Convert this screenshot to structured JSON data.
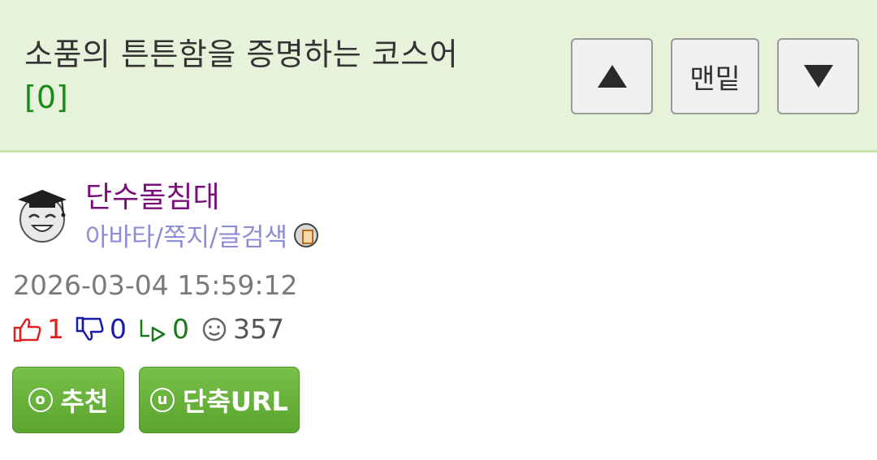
{
  "header": {
    "title": "소품의 튼튼함을 증명하는 코스어",
    "comment_count": "[0]",
    "nav": {
      "up_icon": "triangle-up-icon",
      "bottom_label": "맨밑",
      "down_icon": "triangle-down-icon"
    }
  },
  "author": {
    "avatar_icon": "graduate-smiley-avatar",
    "name": "단수돌침대",
    "links": "아바타/쪽지/글검색",
    "message_icon": "message-icon"
  },
  "meta": {
    "timestamp": "2026-03-04 15:59:12",
    "upvotes": "1",
    "downvotes": "0",
    "replies": "0",
    "views": "357"
  },
  "actions": {
    "recommend_letter": "o",
    "recommend_label": "추천",
    "short_url_letter": "u",
    "short_url_label": "단축URL"
  },
  "colors": {
    "header_bg": "#e6f3da",
    "accent_green": "#5aa52e",
    "author_name": "#7a0f7a",
    "author_links": "#8d8dd6",
    "upvote": "#e02020",
    "downvote": "#1a1aa8",
    "reply": "#1a7a1a"
  }
}
